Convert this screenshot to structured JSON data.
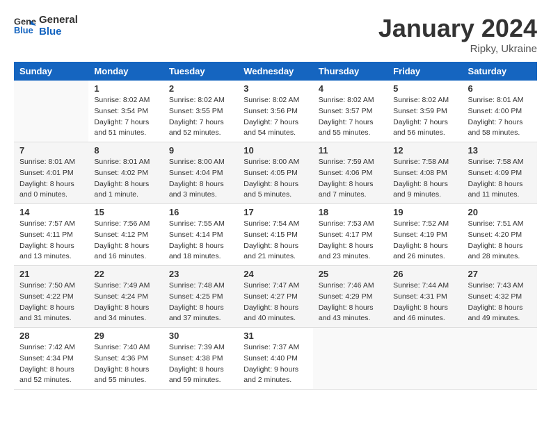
{
  "header": {
    "logo_line1": "General",
    "logo_line2": "Blue",
    "month_year": "January 2024",
    "location": "Ripky, Ukraine"
  },
  "days_of_week": [
    "Sunday",
    "Monday",
    "Tuesday",
    "Wednesday",
    "Thursday",
    "Friday",
    "Saturday"
  ],
  "weeks": [
    [
      {
        "day": "",
        "sunrise": "",
        "sunset": "",
        "daylight": ""
      },
      {
        "day": "1",
        "sunrise": "8:02 AM",
        "sunset": "3:54 PM",
        "daylight": "7 hours and 51 minutes."
      },
      {
        "day": "2",
        "sunrise": "8:02 AM",
        "sunset": "3:55 PM",
        "daylight": "7 hours and 52 minutes."
      },
      {
        "day": "3",
        "sunrise": "8:02 AM",
        "sunset": "3:56 PM",
        "daylight": "7 hours and 54 minutes."
      },
      {
        "day": "4",
        "sunrise": "8:02 AM",
        "sunset": "3:57 PM",
        "daylight": "7 hours and 55 minutes."
      },
      {
        "day": "5",
        "sunrise": "8:02 AM",
        "sunset": "3:59 PM",
        "daylight": "7 hours and 56 minutes."
      },
      {
        "day": "6",
        "sunrise": "8:01 AM",
        "sunset": "4:00 PM",
        "daylight": "7 hours and 58 minutes."
      }
    ],
    [
      {
        "day": "7",
        "sunrise": "8:01 AM",
        "sunset": "4:01 PM",
        "daylight": "8 hours and 0 minutes."
      },
      {
        "day": "8",
        "sunrise": "8:01 AM",
        "sunset": "4:02 PM",
        "daylight": "8 hours and 1 minute."
      },
      {
        "day": "9",
        "sunrise": "8:00 AM",
        "sunset": "4:04 PM",
        "daylight": "8 hours and 3 minutes."
      },
      {
        "day": "10",
        "sunrise": "8:00 AM",
        "sunset": "4:05 PM",
        "daylight": "8 hours and 5 minutes."
      },
      {
        "day": "11",
        "sunrise": "7:59 AM",
        "sunset": "4:06 PM",
        "daylight": "8 hours and 7 minutes."
      },
      {
        "day": "12",
        "sunrise": "7:58 AM",
        "sunset": "4:08 PM",
        "daylight": "8 hours and 9 minutes."
      },
      {
        "day": "13",
        "sunrise": "7:58 AM",
        "sunset": "4:09 PM",
        "daylight": "8 hours and 11 minutes."
      }
    ],
    [
      {
        "day": "14",
        "sunrise": "7:57 AM",
        "sunset": "4:11 PM",
        "daylight": "8 hours and 13 minutes."
      },
      {
        "day": "15",
        "sunrise": "7:56 AM",
        "sunset": "4:12 PM",
        "daylight": "8 hours and 16 minutes."
      },
      {
        "day": "16",
        "sunrise": "7:55 AM",
        "sunset": "4:14 PM",
        "daylight": "8 hours and 18 minutes."
      },
      {
        "day": "17",
        "sunrise": "7:54 AM",
        "sunset": "4:15 PM",
        "daylight": "8 hours and 21 minutes."
      },
      {
        "day": "18",
        "sunrise": "7:53 AM",
        "sunset": "4:17 PM",
        "daylight": "8 hours and 23 minutes."
      },
      {
        "day": "19",
        "sunrise": "7:52 AM",
        "sunset": "4:19 PM",
        "daylight": "8 hours and 26 minutes."
      },
      {
        "day": "20",
        "sunrise": "7:51 AM",
        "sunset": "4:20 PM",
        "daylight": "8 hours and 28 minutes."
      }
    ],
    [
      {
        "day": "21",
        "sunrise": "7:50 AM",
        "sunset": "4:22 PM",
        "daylight": "8 hours and 31 minutes."
      },
      {
        "day": "22",
        "sunrise": "7:49 AM",
        "sunset": "4:24 PM",
        "daylight": "8 hours and 34 minutes."
      },
      {
        "day": "23",
        "sunrise": "7:48 AM",
        "sunset": "4:25 PM",
        "daylight": "8 hours and 37 minutes."
      },
      {
        "day": "24",
        "sunrise": "7:47 AM",
        "sunset": "4:27 PM",
        "daylight": "8 hours and 40 minutes."
      },
      {
        "day": "25",
        "sunrise": "7:46 AM",
        "sunset": "4:29 PM",
        "daylight": "8 hours and 43 minutes."
      },
      {
        "day": "26",
        "sunrise": "7:44 AM",
        "sunset": "4:31 PM",
        "daylight": "8 hours and 46 minutes."
      },
      {
        "day": "27",
        "sunrise": "7:43 AM",
        "sunset": "4:32 PM",
        "daylight": "8 hours and 49 minutes."
      }
    ],
    [
      {
        "day": "28",
        "sunrise": "7:42 AM",
        "sunset": "4:34 PM",
        "daylight": "8 hours and 52 minutes."
      },
      {
        "day": "29",
        "sunrise": "7:40 AM",
        "sunset": "4:36 PM",
        "daylight": "8 hours and 55 minutes."
      },
      {
        "day": "30",
        "sunrise": "7:39 AM",
        "sunset": "4:38 PM",
        "daylight": "8 hours and 59 minutes."
      },
      {
        "day": "31",
        "sunrise": "7:37 AM",
        "sunset": "4:40 PM",
        "daylight": "9 hours and 2 minutes."
      },
      {
        "day": "",
        "sunrise": "",
        "sunset": "",
        "daylight": ""
      },
      {
        "day": "",
        "sunrise": "",
        "sunset": "",
        "daylight": ""
      },
      {
        "day": "",
        "sunrise": "",
        "sunset": "",
        "daylight": ""
      }
    ]
  ]
}
